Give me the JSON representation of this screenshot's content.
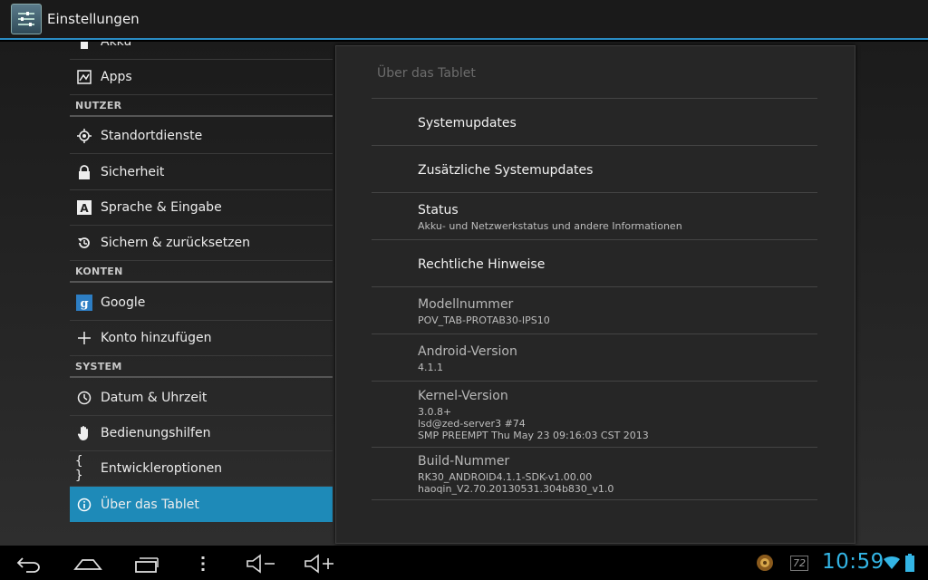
{
  "action_bar": {
    "title": "Einstellungen"
  },
  "sidebar": {
    "items": [
      {
        "label": "Akku",
        "icon": "battery-icon"
      },
      {
        "label": "Apps",
        "icon": "apps-icon"
      },
      {
        "header": "NUTZER"
      },
      {
        "label": "Standortdienste",
        "icon": "location-icon"
      },
      {
        "label": "Sicherheit",
        "icon": "lock-icon"
      },
      {
        "label": "Sprache & Eingabe",
        "icon": "language-icon"
      },
      {
        "label": "Sichern & zurücksetzen",
        "icon": "backup-restore-icon"
      },
      {
        "header": "KONTEN"
      },
      {
        "label": "Google",
        "icon": "google-icon"
      },
      {
        "label": "Konto hinzufügen",
        "icon": "plus-icon"
      },
      {
        "header": "SYSTEM"
      },
      {
        "label": "Datum & Uhrzeit",
        "icon": "clock-icon"
      },
      {
        "label": "Bedienungshilfen",
        "icon": "hand-icon"
      },
      {
        "label": "Entwickleroptionen",
        "icon": "braces-icon"
      },
      {
        "label": "Über das Tablet",
        "icon": "info-icon",
        "selected": true
      }
    ]
  },
  "detail": {
    "title": "Über das Tablet",
    "prefs": [
      {
        "title": "Systemupdates"
      },
      {
        "title": "Zusätzliche Systemupdates"
      },
      {
        "title": "Status",
        "summary": [
          "Akku- und Netzwerkstatus und andere Informationen"
        ]
      },
      {
        "title": "Rechtliche Hinweise"
      },
      {
        "title": "Modellnummer",
        "summary": [
          "POV_TAB-PROTAB30-IPS10"
        ]
      },
      {
        "title": "Android-Version",
        "summary": [
          "4.1.1"
        ]
      },
      {
        "title": "Kernel-Version",
        "summary": [
          "3.0.8+",
          "lsd@zed-server3 #74",
          "SMP PREEMPT Thu May 23 09:16:03 CST 2013"
        ]
      },
      {
        "title": "Build-Nummer",
        "summary": [
          "RK30_ANDROID4.1.1-SDK-v1.00.00",
          "haoqin_V2.70.20130531.304b830_v1.0"
        ]
      }
    ]
  },
  "system_bar": {
    "clock": "10:59",
    "battery_level_text": "72",
    "nav": [
      "back-icon",
      "home-icon",
      "recents-icon",
      "menu-icon",
      "volume-down-icon",
      "volume-up-icon"
    ]
  },
  "colors": {
    "accent": "#33b5e5",
    "selected": "#1e8ab8"
  }
}
